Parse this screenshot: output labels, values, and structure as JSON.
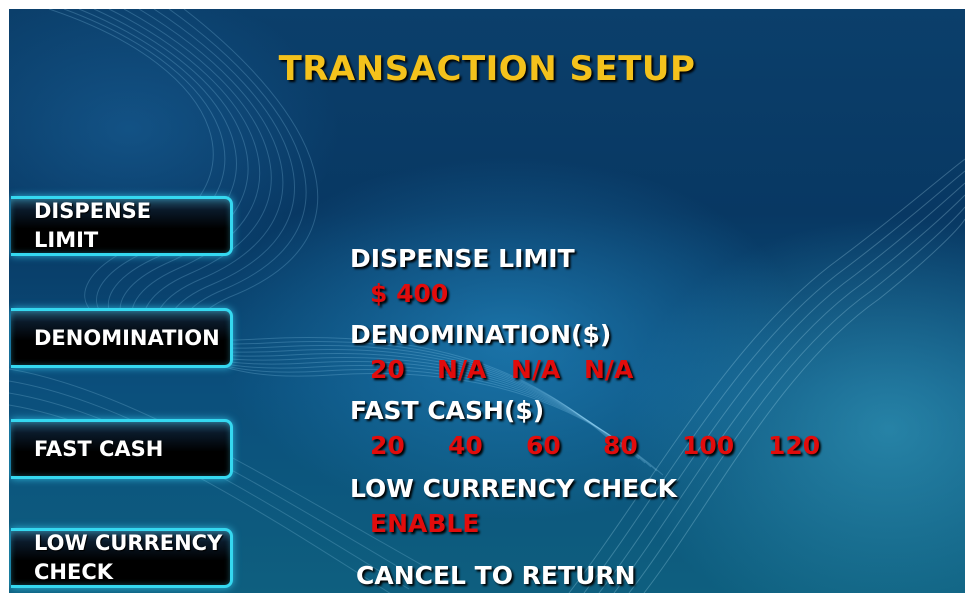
{
  "screen": {
    "title": "TRANSACTION SETUP",
    "side_buttons": [
      {
        "label": "DISPENSE\nLIMIT"
      },
      {
        "label": "DENOMINATION"
      },
      {
        "label": "FAST CASH"
      },
      {
        "label": "LOW CURRENCY\nCHECK"
      }
    ],
    "dispense_limit": {
      "label": "DISPENSE LIMIT",
      "value": "$ 400"
    },
    "denomination": {
      "label": "DENOMINATION($)",
      "values": [
        "20",
        "N/A",
        "N/A",
        "N/A"
      ]
    },
    "fast_cash": {
      "label": "FAST CASH($)",
      "values": [
        "20",
        "40",
        "60",
        "80",
        "100",
        "120"
      ]
    },
    "low_currency_check": {
      "label": "LOW CURRENCY CHECK",
      "value": "ENABLE"
    },
    "footer": "CANCEL TO RETURN"
  },
  "colors": {
    "title": "#f4c21c",
    "value": "#e10c0c",
    "button_border": "#35d8f0",
    "background": "#083863"
  }
}
